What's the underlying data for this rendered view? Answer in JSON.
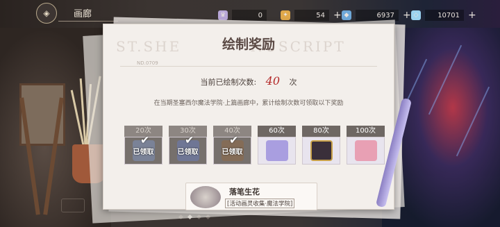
{
  "topbar": {
    "page_title": "画廊",
    "resources": [
      {
        "icon": "avatar-token-icon",
        "value": "0",
        "color": "#b7a6d6"
      },
      {
        "icon": "magic-book-icon",
        "value": "54",
        "color": "#e0a84a"
      },
      {
        "icon": "crystal-icon",
        "value": "6937",
        "color": "#6fa8d8"
      },
      {
        "icon": "diamond-icon",
        "value": "10701",
        "color": "#9bd2f0"
      }
    ]
  },
  "panel": {
    "watermark": "ST.SHE",
    "watermark2": "NUSCRIPT",
    "nd_code": "ND.0709",
    "title": "绘制奖励",
    "count_prefix": "当前已绘制次数:",
    "count_value": "40",
    "count_suffix": "次",
    "description": "在当期圣塞西尔魔法学院·上篇画廊中，累计绘制次数可领取以下奖励",
    "claimed_label": "已领取",
    "rewards": [
      {
        "label": "20次",
        "claimed": true,
        "item_color": "#7d8db4"
      },
      {
        "label": "30次",
        "claimed": true,
        "item_color": "#6a7ab0"
      },
      {
        "label": "40次",
        "claimed": true,
        "item_color": "#8a6b4f"
      },
      {
        "label": "60次",
        "claimed": false,
        "item_color": "#a99ee0"
      },
      {
        "label": "80次",
        "claimed": false,
        "item_color": "#3a2f3a"
      },
      {
        "label": "100次",
        "claimed": false,
        "item_color": "#e8a0b4"
      }
    ],
    "bottom_item": {
      "name": "落笔生花",
      "tag": "[活动画灵收集·魔法学院]"
    }
  }
}
